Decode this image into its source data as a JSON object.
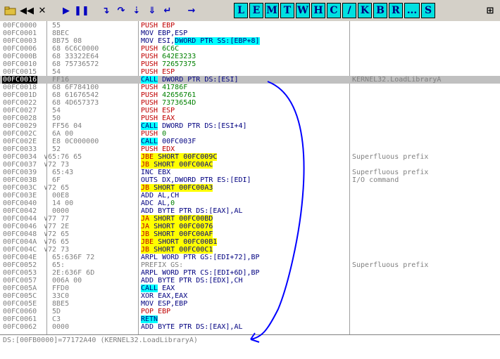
{
  "toolbar": {
    "buttons": [
      {
        "label": "",
        "icon": "open-folder-icon"
      },
      {
        "label": "◀◀",
        "icon": "restart-icon"
      },
      {
        "label": "✕",
        "icon": "close-icon"
      },
      {
        "label": "▶",
        "icon": "run-icon"
      },
      {
        "label": "❚❚",
        "icon": "pause-icon"
      },
      {
        "label": "↴",
        "icon": "step-into-icon"
      },
      {
        "label": "↷",
        "icon": "step-over-icon"
      },
      {
        "label": "⇣",
        "icon": "trace-into-icon"
      },
      {
        "label": "⇓",
        "icon": "trace-over-icon"
      },
      {
        "label": "↵",
        "icon": "execute-till-return-icon"
      },
      {
        "label": "→",
        "icon": "go-to-address-icon"
      }
    ],
    "windows": [
      "L",
      "E",
      "M",
      "T",
      "W",
      "H",
      "C",
      "/",
      "K",
      "B",
      "R",
      "...",
      "S"
    ],
    "extra_icon": "grid-icon"
  },
  "rows": [
    {
      "addr": "00FC0000",
      "hex": "55",
      "asm": "PUSH EBP",
      "cmt": ""
    },
    {
      "addr": "00FC0001",
      "hex": "8BEC",
      "asm": "MOV EBP,ESP",
      "cmt": ""
    },
    {
      "addr": "00FC0003",
      "hex": "8B75 08",
      "asm": "MOV ESI,",
      "asm_hl": "DWORD PTR SS:[EBP+8]",
      "cmt": ""
    },
    {
      "addr": "00FC0006",
      "hex": "68 6C6C0000",
      "asm": "PUSH ",
      "asm_num": "6C6C",
      "cmt": ""
    },
    {
      "addr": "00FC000B",
      "hex": "68 33322E64",
      "asm": "PUSH ",
      "asm_num": "642E3233",
      "cmt": ""
    },
    {
      "addr": "00FC0010",
      "hex": "68 75736572",
      "asm": "PUSH ",
      "asm_num": "72657375",
      "cmt": ""
    },
    {
      "addr": "00FC0015",
      "hex": "54",
      "asm": "PUSH ESP",
      "cmt": ""
    },
    {
      "addr": "00FC0016",
      "hex": "FF16",
      "asm": "CALL",
      "asm_rest": " DWORD PTR DS:[ESI]",
      "cmt": "KERNEL32.LoadLibraryA",
      "selected": true
    },
    {
      "addr": "00FC0018",
      "hex": "68 6F784100",
      "asm": "PUSH ",
      "asm_num": "41786F",
      "cmt": ""
    },
    {
      "addr": "00FC001D",
      "hex": "68 61676542",
      "asm": "PUSH ",
      "asm_num": "42656761",
      "cmt": ""
    },
    {
      "addr": "00FC0022",
      "hex": "68 4D657373",
      "asm": "PUSH ",
      "asm_num": "7373654D",
      "cmt": ""
    },
    {
      "addr": "00FC0027",
      "hex": "54",
      "asm": "PUSH ESP",
      "cmt": ""
    },
    {
      "addr": "00FC0028",
      "hex": "50",
      "asm": "PUSH EAX",
      "cmt": ""
    },
    {
      "addr": "00FC0029",
      "hex": "FF56 04",
      "asm": "CALL",
      "asm_rest": " DWORD PTR DS:[ESI+4]",
      "cmt": ""
    },
    {
      "addr": "00FC002C",
      "hex": "6A 00",
      "asm": "PUSH ",
      "asm_num": "0",
      "cmt": ""
    },
    {
      "addr": "00FC002E",
      "hex": "E8 0C000000",
      "asm": "CALL",
      "asm_rest": " 00FC003F",
      "cmt": ""
    },
    {
      "addr": "00FC0033",
      "hex": "52",
      "asm": "PUSH EDX",
      "cmt": ""
    },
    {
      "addr": "00FC0034",
      "hex": "65:76 65",
      "asm": "JBE",
      "asm_rest": " SHORT 00FC009C",
      "jump": true,
      "cmt": "Superfluous prefix"
    },
    {
      "addr": "00FC0037",
      "hex": "72 73",
      "asm": "JB",
      "asm_rest": " SHORT 00FC00AC",
      "jump": true,
      "cmt": ""
    },
    {
      "addr": "00FC0039",
      "hex": "65:43",
      "asm": "INC EBX",
      "cmt": "Superfluous prefix"
    },
    {
      "addr": "00FC003B",
      "hex": "6F",
      "asm": "OUTS DX,DWORD PTR ES:[EDI]",
      "cmt": "I/O command"
    },
    {
      "addr": "00FC003C",
      "hex": "72 65",
      "asm": "JB",
      "asm_rest": " SHORT 00FC00A3",
      "jump": true,
      "cmt": ""
    },
    {
      "addr": "00FC003E",
      "hex": "00E8",
      "asm": "ADD AL,CH",
      "cmt": ""
    },
    {
      "addr": "00FC0040",
      "hex": "14 00",
      "asm": "ADC AL,",
      "asm_num": "0",
      "cmt": ""
    },
    {
      "addr": "00FC0042",
      "hex": "0000",
      "asm": "ADD BYTE PTR DS:[EAX],AL",
      "cmt": ""
    },
    {
      "addr": "00FC0044",
      "hex": "77 77",
      "asm": "JA",
      "asm_rest": " SHORT 00FC00BD",
      "jump": true,
      "cmt": ""
    },
    {
      "addr": "00FC0046",
      "hex": "77 2E",
      "asm": "JA",
      "asm_rest": " SHORT 00FC0076",
      "jump": true,
      "cmt": ""
    },
    {
      "addr": "00FC0048",
      "hex": "72 65",
      "asm": "JB",
      "asm_rest": " SHORT 00FC00AF",
      "jump": true,
      "cmt": ""
    },
    {
      "addr": "00FC004A",
      "hex": "76 65",
      "asm": "JBE",
      "asm_rest": " SHORT 00FC00B1",
      "jump": true,
      "cmt": ""
    },
    {
      "addr": "00FC004C",
      "hex": "72 73",
      "asm": "JB",
      "asm_rest": " SHORT 00FC00C1",
      "jump": true,
      "cmt": ""
    },
    {
      "addr": "00FC004E",
      "hex": "65:636F 72",
      "asm": "ARPL WORD PTR GS:[EDI+72],BP",
      "cmt": ""
    },
    {
      "addr": "00FC0052",
      "hex": "65:",
      "asm": "PREFIX GS:",
      "gray": true,
      "cmt": "Superfluous prefix"
    },
    {
      "addr": "00FC0053",
      "hex": "2E:636F 6D",
      "asm": "ARPL WORD PTR CS:[EDI+6D],BP",
      "cmt": ""
    },
    {
      "addr": "00FC0057",
      "hex": "006A 00",
      "asm": "ADD BYTE PTR DS:[EDX],CH",
      "cmt": ""
    },
    {
      "addr": "00FC005A",
      "hex": "FFD0",
      "asm": "CALL",
      "asm_rest": " EAX",
      "cmt": ""
    },
    {
      "addr": "00FC005C",
      "hex": "33C0",
      "asm": "XOR EAX,EAX",
      "cmt": ""
    },
    {
      "addr": "00FC005E",
      "hex": "8BE5",
      "asm": "MOV ESP,EBP",
      "cmt": ""
    },
    {
      "addr": "00FC0060",
      "hex": "5D",
      "asm": "POP EBP",
      "cmt": ""
    },
    {
      "addr": "00FC0061",
      "hex": "C3",
      "asm": "RETN",
      "retn": true,
      "cmt": ""
    },
    {
      "addr": "00FC0062",
      "hex": "0000",
      "asm": "ADD BYTE PTR DS:[EAX],AL",
      "cmt": ""
    }
  ],
  "info": {
    "line1": "DS:[00FB0000]=77172A40 (KERNEL32.LoadLibraryA)"
  },
  "colors": {
    "cyan": "#00ffff",
    "yellow": "#ffff00",
    "annotation": "#0000ff"
  }
}
